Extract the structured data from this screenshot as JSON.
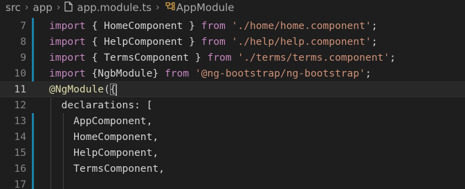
{
  "breadcrumb": {
    "items": [
      "src",
      "app",
      "app.module.ts",
      "AppModule"
    ]
  },
  "code": {
    "lines": [
      {
        "number": "7",
        "modified": true,
        "tokens": [
          {
            "t": "kw",
            "v": "import"
          },
          {
            "t": "punc",
            "v": " { "
          },
          {
            "t": "ident",
            "v": "HomeComponent"
          },
          {
            "t": "punc",
            "v": " } "
          },
          {
            "t": "kw",
            "v": "from"
          },
          {
            "t": "punc",
            "v": " "
          },
          {
            "t": "str",
            "v": "'./home/home.component'"
          },
          {
            "t": "punc",
            "v": ";"
          }
        ]
      },
      {
        "number": "8",
        "modified": true,
        "tokens": [
          {
            "t": "kw",
            "v": "import"
          },
          {
            "t": "punc",
            "v": " { "
          },
          {
            "t": "ident",
            "v": "HelpComponent"
          },
          {
            "t": "punc",
            "v": " } "
          },
          {
            "t": "kw",
            "v": "from"
          },
          {
            "t": "punc",
            "v": " "
          },
          {
            "t": "str",
            "v": "'./help/help.component'"
          },
          {
            "t": "punc",
            "v": ";"
          }
        ]
      },
      {
        "number": "9",
        "modified": true,
        "tokens": [
          {
            "t": "kw",
            "v": "import"
          },
          {
            "t": "punc",
            "v": " { "
          },
          {
            "t": "ident",
            "v": "TermsComponent"
          },
          {
            "t": "punc",
            "v": " } "
          },
          {
            "t": "kw",
            "v": "from"
          },
          {
            "t": "punc",
            "v": " "
          },
          {
            "t": "str",
            "v": "'./terms/terms.component'"
          },
          {
            "t": "punc",
            "v": ";"
          }
        ]
      },
      {
        "number": "10",
        "modified": true,
        "tokens": [
          {
            "t": "kw",
            "v": "import"
          },
          {
            "t": "punc",
            "v": " {"
          },
          {
            "t": "ident",
            "v": "NgbModule"
          },
          {
            "t": "punc",
            "v": "} "
          },
          {
            "t": "kw",
            "v": "from"
          },
          {
            "t": "punc",
            "v": " "
          },
          {
            "t": "str",
            "v": "'@ng-bootstrap/ng-bootstrap'"
          },
          {
            "t": "punc",
            "v": ";"
          }
        ]
      },
      {
        "number": "11",
        "modified": false,
        "current": true,
        "tokens": [
          {
            "t": "dec",
            "v": "@NgModule"
          },
          {
            "t": "punc",
            "v": "("
          },
          {
            "t": "bracket",
            "v": "{"
          }
        ]
      },
      {
        "number": "12",
        "modified": false,
        "tokens": [
          {
            "t": "punc",
            "v": "  "
          },
          {
            "t": "prop",
            "v": "declarations"
          },
          {
            "t": "punc",
            "v": ": ["
          }
        ]
      },
      {
        "number": "13",
        "modified": true,
        "tokens": [
          {
            "t": "punc",
            "v": "    "
          },
          {
            "t": "ident",
            "v": "AppComponent"
          },
          {
            "t": "punc",
            "v": ","
          }
        ]
      },
      {
        "number": "14",
        "modified": true,
        "tokens": [
          {
            "t": "punc",
            "v": "    "
          },
          {
            "t": "ident",
            "v": "HomeComponent"
          },
          {
            "t": "punc",
            "v": ","
          }
        ]
      },
      {
        "number": "15",
        "modified": true,
        "tokens": [
          {
            "t": "punc",
            "v": "    "
          },
          {
            "t": "ident",
            "v": "HelpComponent"
          },
          {
            "t": "punc",
            "v": ","
          }
        ]
      },
      {
        "number": "16",
        "modified": true,
        "tokens": [
          {
            "t": "punc",
            "v": "    "
          },
          {
            "t": "ident",
            "v": "TermsComponent"
          },
          {
            "t": "punc",
            "v": ","
          }
        ]
      },
      {
        "number": "17",
        "modified": true,
        "tokens": []
      }
    ]
  },
  "colors": {
    "background": "#1e1e1e",
    "keyword": "#c586c0",
    "string": "#ce9178",
    "decorator": "#dcdcaa",
    "modified_gutter": "#1b81a8"
  }
}
